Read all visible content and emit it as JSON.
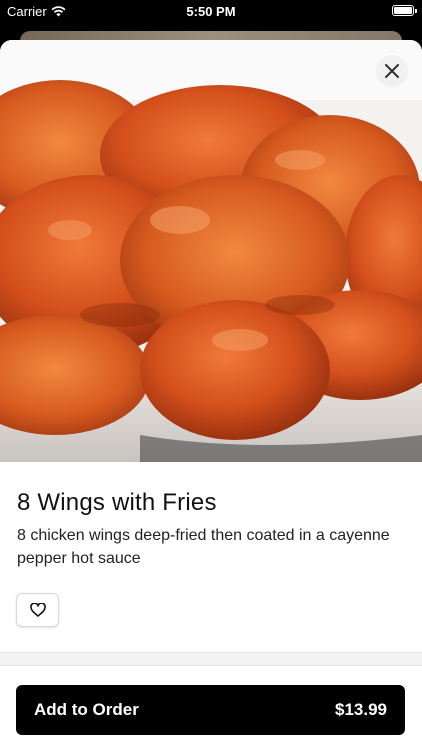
{
  "status_bar": {
    "carrier": "Carrier",
    "time": "5:50 PM"
  },
  "item": {
    "title": "8 Wings with Fries",
    "description": "8 chicken wings deep-fried then coated in a cayenne pepper hot sauce",
    "image_icon": "chicken-wings-photo"
  },
  "actions": {
    "close_icon": "close-icon",
    "favorite_icon": "heart-icon",
    "add_to_order_label": "Add to Order",
    "price": "$13.99"
  },
  "colors": {
    "primary_button": "#000000",
    "sheet_background": "#ffffff",
    "text": "#111111"
  }
}
